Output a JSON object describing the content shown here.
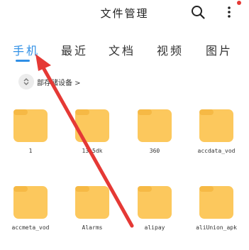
{
  "header": {
    "title": "文件管理",
    "search_icon": "search-icon",
    "more_icon": "more-vertical-icon"
  },
  "tabs": [
    {
      "label": "手机",
      "active": true
    },
    {
      "label": "最近",
      "active": false
    },
    {
      "label": "文档",
      "active": false
    },
    {
      "label": "视频",
      "active": false
    },
    {
      "label": "图片",
      "active": false
    }
  ],
  "breadcrumb": {
    "icon": "expand-collapse-icon",
    "label": "部存储设备 >"
  },
  "folders": [
    {
      "name": "1"
    },
    {
      "name": "13e5dk"
    },
    {
      "name": "360"
    },
    {
      "name": "accdata_vod"
    },
    {
      "name": "accmeta_vod"
    },
    {
      "name": "Alarms"
    },
    {
      "name": "alipay"
    },
    {
      "name": "aliUnion_apk"
    }
  ],
  "colors": {
    "accent": "#2f8fe6",
    "folder": "#fcc85d",
    "annotation_arrow": "#e53935"
  }
}
